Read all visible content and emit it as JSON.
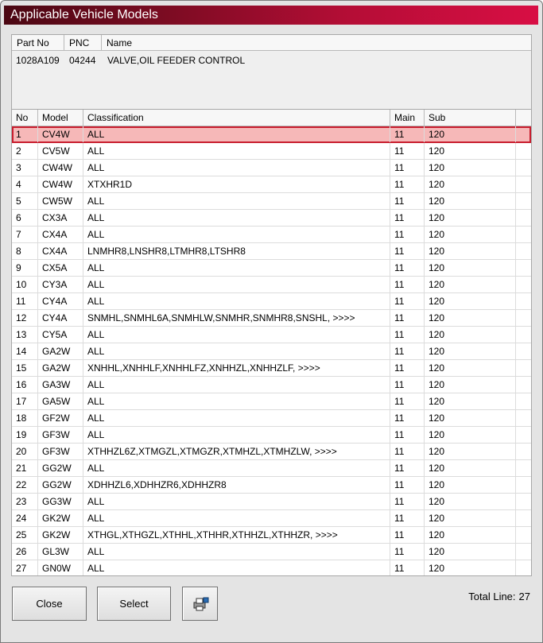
{
  "window": {
    "title": "Applicable Vehicle Models"
  },
  "part": {
    "headers": [
      "Part No",
      "PNC",
      "Name"
    ],
    "part_no": "1028A109",
    "pnc": "04244",
    "name": "VALVE,OIL FEEDER CONTROL"
  },
  "grid": {
    "headers": [
      "No",
      "Model",
      "Classification",
      "Main",
      "Sub"
    ],
    "selected_index": 0,
    "rows": [
      {
        "no": "1",
        "model": "CV4W",
        "classification": "ALL",
        "main": "11",
        "sub": "120"
      },
      {
        "no": "2",
        "model": "CV5W",
        "classification": "ALL",
        "main": "11",
        "sub": "120"
      },
      {
        "no": "3",
        "model": "CW4W",
        "classification": "ALL",
        "main": "11",
        "sub": "120"
      },
      {
        "no": "4",
        "model": "CW4W",
        "classification": "XTXHR1D",
        "main": "11",
        "sub": "120"
      },
      {
        "no": "5",
        "model": "CW5W",
        "classification": "ALL",
        "main": "11",
        "sub": "120"
      },
      {
        "no": "6",
        "model": "CX3A",
        "classification": "ALL",
        "main": "11",
        "sub": "120"
      },
      {
        "no": "7",
        "model": "CX4A",
        "classification": "ALL",
        "main": "11",
        "sub": "120"
      },
      {
        "no": "8",
        "model": "CX4A",
        "classification": "LNMHR8,LNSHR8,LTMHR8,LTSHR8",
        "main": "11",
        "sub": "120"
      },
      {
        "no": "9",
        "model": "CX5A",
        "classification": "ALL",
        "main": "11",
        "sub": "120"
      },
      {
        "no": "10",
        "model": "CY3A",
        "classification": "ALL",
        "main": "11",
        "sub": "120"
      },
      {
        "no": "11",
        "model": "CY4A",
        "classification": "ALL",
        "main": "11",
        "sub": "120"
      },
      {
        "no": "12",
        "model": "CY4A",
        "classification": "SNMHL,SNMHL6A,SNMHLW,SNMHR,SNMHR8,SNSHL,  >>>>",
        "main": "11",
        "sub": "120"
      },
      {
        "no": "13",
        "model": "CY5A",
        "classification": "ALL",
        "main": "11",
        "sub": "120"
      },
      {
        "no": "14",
        "model": "GA2W",
        "classification": "ALL",
        "main": "11",
        "sub": "120"
      },
      {
        "no": "15",
        "model": "GA2W",
        "classification": "XNHHL,XNHHLF,XNHHLFZ,XNHHZL,XNHHZLF,  >>>>",
        "main": "11",
        "sub": "120"
      },
      {
        "no": "16",
        "model": "GA3W",
        "classification": "ALL",
        "main": "11",
        "sub": "120"
      },
      {
        "no": "17",
        "model": "GA5W",
        "classification": "ALL",
        "main": "11",
        "sub": "120"
      },
      {
        "no": "18",
        "model": "GF2W",
        "classification": "ALL",
        "main": "11",
        "sub": "120"
      },
      {
        "no": "19",
        "model": "GF3W",
        "classification": "ALL",
        "main": "11",
        "sub": "120"
      },
      {
        "no": "20",
        "model": "GF3W",
        "classification": "XTHHZL6Z,XTMGZL,XTMGZR,XTMHZL,XTMHZLW,  >>>>",
        "main": "11",
        "sub": "120"
      },
      {
        "no": "21",
        "model": "GG2W",
        "classification": "ALL",
        "main": "11",
        "sub": "120"
      },
      {
        "no": "22",
        "model": "GG2W",
        "classification": "XDHHZL6,XDHHZR6,XDHHZR8",
        "main": "11",
        "sub": "120"
      },
      {
        "no": "23",
        "model": "GG3W",
        "classification": "ALL",
        "main": "11",
        "sub": "120"
      },
      {
        "no": "24",
        "model": "GK2W",
        "classification": "ALL",
        "main": "11",
        "sub": "120"
      },
      {
        "no": "25",
        "model": "GK2W",
        "classification": "XTHGL,XTHGZL,XTHHL,XTHHR,XTHHZL,XTHHZR,  >>>>",
        "main": "11",
        "sub": "120"
      },
      {
        "no": "26",
        "model": "GL3W",
        "classification": "ALL",
        "main": "11",
        "sub": "120"
      },
      {
        "no": "27",
        "model": "GN0W",
        "classification": "ALL",
        "main": "11",
        "sub": "120"
      }
    ]
  },
  "buttons": {
    "close": "Close",
    "select": "Select",
    "print_icon": "printer-icon"
  },
  "footer": {
    "total_label": "Total Line:",
    "total_value": "27"
  },
  "colors": {
    "title_start": "#4a0712",
    "title_end": "#d80e44",
    "selected_bg": "#f6b8b8",
    "selected_border": "#c81d2e"
  }
}
